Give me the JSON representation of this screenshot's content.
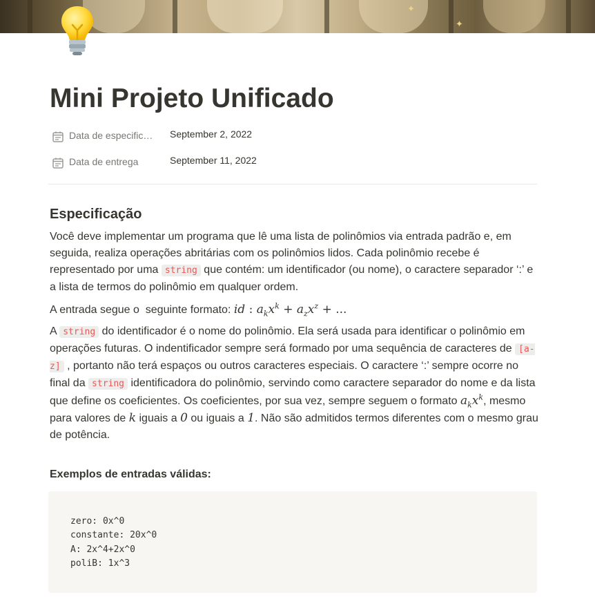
{
  "page": {
    "title": "Mini Projeto Unificado",
    "icon": "light-bulb-icon"
  },
  "properties": [
    {
      "icon": "calendar-icon",
      "name": "Data de especific…",
      "value": "September 2, 2022"
    },
    {
      "icon": "calendar-icon",
      "name": "Data de entrega",
      "value": "September 11, 2022"
    }
  ],
  "content": {
    "heading": "Especificação",
    "p1": {
      "before": "Você deve implementar um programa que lê uma lista de polinômios via entrada padrão e, em seguida, realiza operações abritárias com os polinômios lidos. Cada polinômio recebe é representado por uma ",
      "code": "string",
      "after": " que contém: um identificador (ou nome), o caractere separador ‘:’ e a lista de termos do polinômio em qualquer ordem."
    },
    "p2": {
      "text": "A entrada segue o  seguinte formato: ",
      "formula": {
        "id": "id",
        "colon": ":",
        "a": "a",
        "sub_k": "k",
        "x": "x",
        "sup_k": "k",
        "plus": "+",
        "sub_z": "z",
        "sup_z": "z",
        "ellipsis": "+ ..."
      }
    },
    "p3": {
      "t1": "A ",
      "code1": "string",
      "t2": " do identificador é o nome do polinômio. Ela será usada para identificar o polinômio em operações futuras. O indentificador sempre será formado por uma sequência de caracteres de ",
      "code2": "[a-z]",
      "t3": " , portanto não terá espaços ou outros caracteres especiais. O caractere ‘:’ sempre ocorre no final da ",
      "code3": "string",
      "t4": " identificadora do polinômio, servindo como caractere separador do nome e da lista que define os coeficientes. Os coeficientes, por sua vez, sempre seguem o formato ",
      "m_a": "a",
      "m_k": "k",
      "m_x": "x",
      "m_supk": "k",
      "t5": ", mesmo para valores de ",
      "m_k2": "k",
      "t6": " iguais a ",
      "m_0": "0",
      "t7": " ou iguais a ",
      "m_1": "1",
      "t8": ". Não são admitidos termos diferentes com o mesmo grau de potência."
    },
    "examples_label": "Exemplos de entradas válidas:",
    "examples": [
      "zero: 0x^0",
      "constante: 20x^0",
      "A: 2x^4+2x^0",
      "poliB: 1x^3"
    ]
  },
  "colors": {
    "text": "#37352f",
    "muted": "#787774",
    "inline_code": "#eb5757",
    "code_bg": "#f7f6f3"
  }
}
